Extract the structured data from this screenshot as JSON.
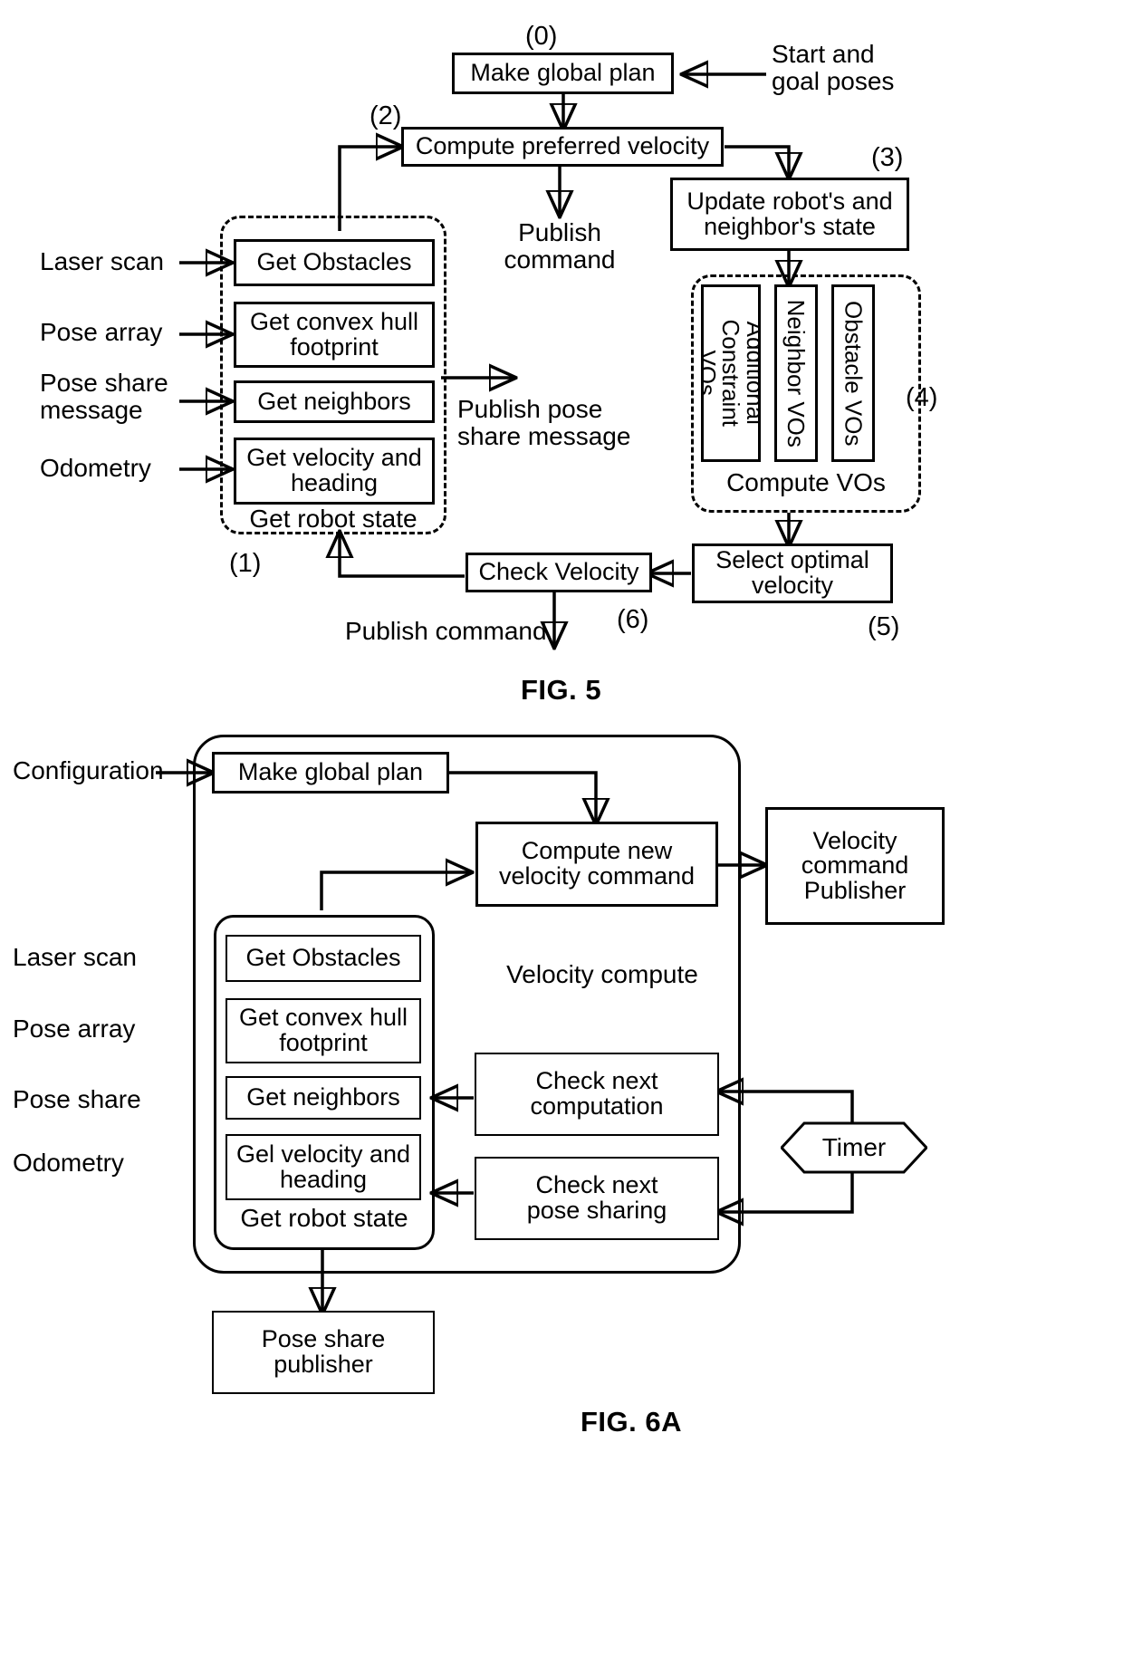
{
  "figures": [
    {
      "id": "fig5",
      "caption": "FIG. 5",
      "boxes": {
        "make_global_plan": "Make global plan",
        "compute_preferred_velocity": "Compute preferred velocity",
        "update_state": "Update robot's and\nneighbor's state",
        "get_obstacles": "Get Obstacles",
        "get_convex_hull": "Get convex hull\nfootprint",
        "get_neighbors": "Get neighbors",
        "get_velocity_heading": "Get velocity and\nheading",
        "check_velocity": "Check Velocity",
        "select_optimal_velocity": "Select optimal\nvelocity",
        "additional_constraint_vos": "Additional\nConstraint VOs",
        "neighbor_vos": "Neighbor VOs",
        "obstacle_vos": "Obstacle VOs"
      },
      "group_labels": {
        "get_robot_state": "Get robot state",
        "compute_vos": "Compute VOs"
      },
      "io_labels": {
        "start_goal": "Start and\ngoal poses",
        "laser_scan": "Laser scan",
        "pose_array": "Pose array",
        "pose_share_message": "Pose share\nmessage",
        "odometry": "Odometry",
        "publish_command_top": "Publish\ncommand",
        "publish_pose_share": "Publish pose\nshare message",
        "publish_command_bottom": "Publish command"
      },
      "ref_numbers": {
        "n0": "(0)",
        "n1": "(1)",
        "n2": "(2)",
        "n3": "(3)",
        "n4": "(4)",
        "n5": "(5)",
        "n6": "(6)"
      }
    },
    {
      "id": "fig6a",
      "caption": "FIG. 6A",
      "boxes": {
        "make_global_plan": "Make global plan",
        "compute_new_velocity": "Compute new\nvelocity command",
        "velocity_command_publisher": "Velocity\ncommand\nPublisher",
        "get_obstacles": "Get Obstacles",
        "get_convex_hull": "Get convex hull\nfootprint",
        "get_neighbors": "Get neighbors",
        "get_velocity_heading": "Gel velocity and\nheading",
        "check_next_computation": "Check next\ncomputation",
        "check_next_pose_sharing": "Check next\npose sharing",
        "pose_share_publisher": "Pose share\npublisher",
        "timer": "Timer"
      },
      "group_labels": {
        "get_robot_state": "Get robot state",
        "velocity_compute": "Velocity compute"
      },
      "io_labels": {
        "configuration": "Configuration",
        "laser_scan": "Laser scan",
        "pose_array": "Pose array",
        "pose_share": "Pose share",
        "odometry": "Odometry"
      }
    }
  ],
  "colors": {
    "ink": "#000000",
    "paper": "#ffffff"
  }
}
